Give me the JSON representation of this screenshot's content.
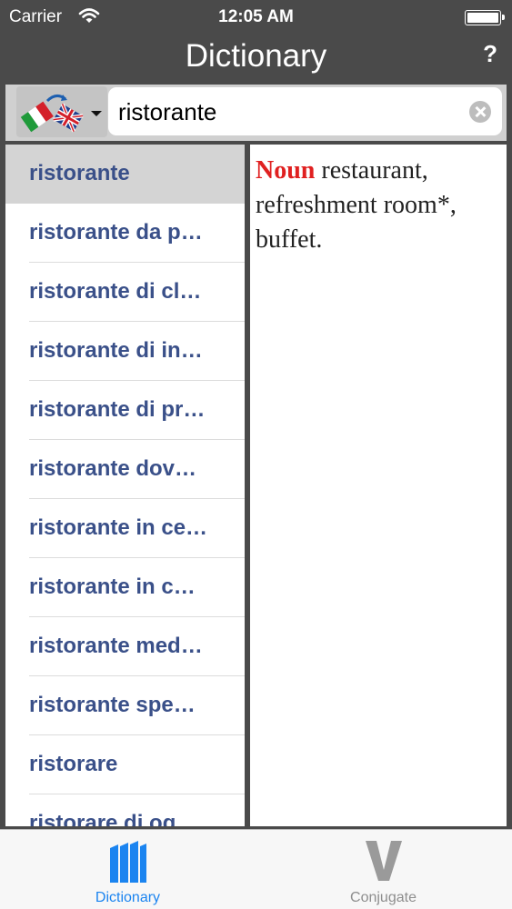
{
  "status_bar": {
    "carrier": "Carrier",
    "time": "12:05 AM",
    "wifi_icon": "wifi-icon",
    "battery_icon": "battery-icon",
    "battery_level": 1.0
  },
  "navigation": {
    "title": "Dictionary",
    "help_label": "?"
  },
  "search": {
    "language_flags": [
      "italian-flag-icon",
      "uk-flag-icon"
    ],
    "query": "ristorante",
    "clear_icon": "clear-icon"
  },
  "word_list": {
    "selected_index": 0,
    "items": [
      "ristorante",
      "ristorante da p…",
      "ristorante di cl…",
      "ristorante di in…",
      "ristorante di pr…",
      "ristorante dov…",
      "ristorante in ce…",
      "ristorante in c…",
      "ristorante med…",
      "ristorante spe…",
      "ristorare",
      "ristorare di og…"
    ]
  },
  "definition": {
    "part_of_speech": "Noun",
    "text": " restaurant, refreshment room*, buffet."
  },
  "tab_bar": {
    "tabs": [
      {
        "label": "Dictionary",
        "icon": "books-icon",
        "active": true
      },
      {
        "label": "Conjugate",
        "icon": "conjugate-v-icon",
        "active": false
      }
    ]
  },
  "colors": {
    "header_bg": "#4a4a4a",
    "list_link": "#3a5089",
    "part_of_speech": "#e02020",
    "tab_active": "#1b84f0",
    "tab_inactive": "#8e8e8e"
  }
}
